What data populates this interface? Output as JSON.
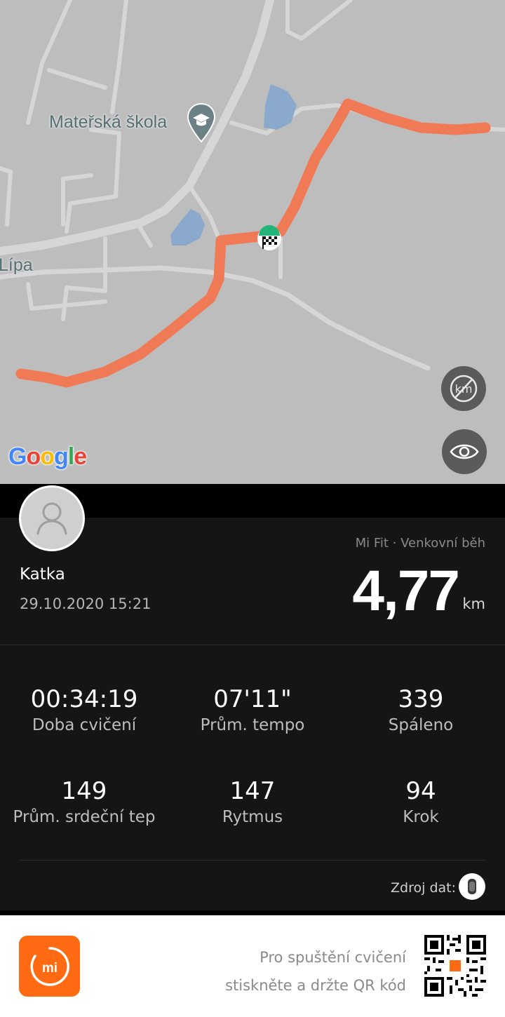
{
  "map": {
    "labels": {
      "school": "Mateřská škola",
      "town": "Lípa"
    },
    "provider_logo": "Google",
    "route_color": "#f07a55",
    "icons": {
      "school_pin": "school-pin-icon",
      "finish": "finish-flag-icon",
      "toggle_km": "km-off-icon",
      "toggle_view": "eye-icon"
    }
  },
  "workout": {
    "user_name": "Katka",
    "datetime": "29.10.2020 15:21",
    "source_title": "Mi Fit · Venkovní běh",
    "distance": "4,77",
    "distance_unit": "km",
    "stats": [
      {
        "value": "00:34:19",
        "label": "Doba cvičení"
      },
      {
        "value": "07'11\"",
        "label": "Prům. tempo"
      },
      {
        "value": "339",
        "label": "Spáleno"
      },
      {
        "value": "149",
        "label": "Prům. srdeční tep"
      },
      {
        "value": "147",
        "label": "Rytmus"
      },
      {
        "value": "94",
        "label": "Krok"
      }
    ],
    "data_source_label": "Zdroj dat:"
  },
  "footer": {
    "hint_line1": "Pro spuštění cvičení",
    "hint_line2": "stiskněte a držte QR kód",
    "brand_color": "#ff6a13"
  }
}
